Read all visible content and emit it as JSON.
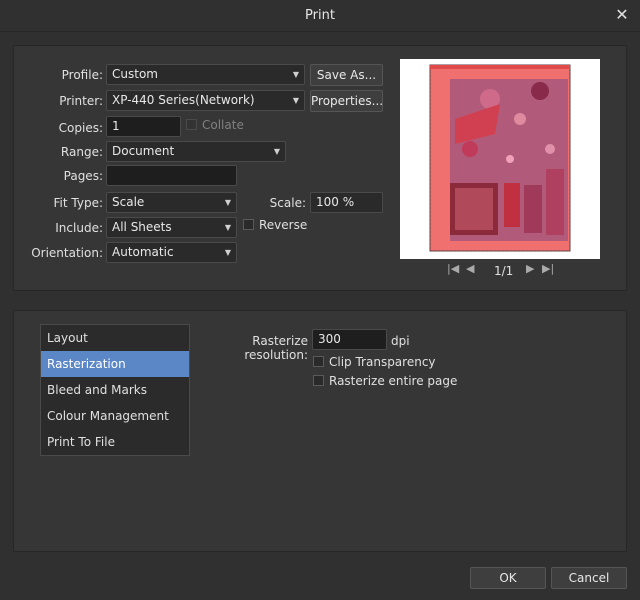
{
  "window": {
    "title": "Print"
  },
  "profile": {
    "label": "Profile:",
    "value": "Custom",
    "save_as": "Save As..."
  },
  "printer": {
    "label": "Printer:",
    "value": "XP-440 Series(Network)",
    "properties": "Properties..."
  },
  "copies": {
    "label": "Copies:",
    "value": "1",
    "collate": "Collate"
  },
  "range": {
    "label": "Range:",
    "value": "Document"
  },
  "pages": {
    "label": "Pages:",
    "value": ""
  },
  "fit_type": {
    "label": "Fit Type:",
    "value": "Scale"
  },
  "scale": {
    "label": "Scale:",
    "value": "100 %"
  },
  "include": {
    "label": "Include:",
    "value": "All Sheets",
    "reverse": "Reverse"
  },
  "orientation": {
    "label": "Orientation:",
    "value": "Automatic"
  },
  "preview_nav": {
    "page_indicator": "1/1"
  },
  "sidebar": {
    "items": [
      {
        "label": "Layout",
        "selected": false
      },
      {
        "label": "Rasterization",
        "selected": true
      },
      {
        "label": "Bleed and Marks",
        "selected": false
      },
      {
        "label": "Colour Management",
        "selected": false
      },
      {
        "label": "Print To File",
        "selected": false
      }
    ]
  },
  "rasterization": {
    "resolution_label": "Rasterize resolution:",
    "resolution_value": "300",
    "unit": "dpi",
    "clip_transparency": "Clip Transparency",
    "rasterize_entire_page": "Rasterize entire page"
  },
  "footer": {
    "ok": "OK",
    "cancel": "Cancel"
  },
  "colors": {
    "accent": "#5b87c7",
    "background": "#303030"
  }
}
